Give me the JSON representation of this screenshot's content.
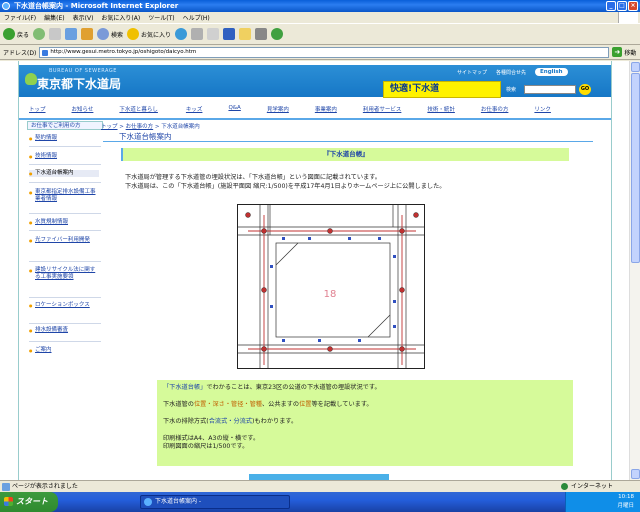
{
  "window": {
    "title": "下水道台帳案内 - Microsoft Internet Explorer"
  },
  "menu": [
    "ファイル(F)",
    "編集(E)",
    "表示(V)",
    "お気に入り(A)",
    "ツール(T)",
    "ヘルプ(H)"
  ],
  "toolbar": {
    "back": "戻る",
    "search": "検索",
    "favorites": "お気に入り"
  },
  "address": {
    "label": "アドレス(D)",
    "url": "http://www.gesui.metro.tokyo.jp/oshigoto/daicyo.htm",
    "go": "移動"
  },
  "header": {
    "sub": "BUREAU OF SEWERAGE",
    "logo": "東京都下水道局",
    "sitemap": "サイトマップ",
    "contact": "各種問合せ先",
    "english": "English",
    "banner": "快適!下水道",
    "search_label": "検索",
    "go": "GO"
  },
  "nav": [
    "トップ",
    "お知らせ",
    "下水道と暮らし",
    "キッズ",
    "Q&A",
    "見学案内",
    "事業案内",
    "利用者サービス",
    "技術・統計",
    "お仕事の方",
    "リンク"
  ],
  "sidebar": {
    "head": "お仕事でご利用の方",
    "items": [
      "契約情報",
      "技術情報",
      "下水道台帳案内",
      "東京都指定排水設備工事業者情報",
      "水質規制情報",
      "光ファイバー利用開発",
      "建設リサイクル法に関する工事実施要領",
      "ロケーションボックス",
      "排水設備審査",
      "ご案内"
    ]
  },
  "crumb": {
    "top": "トップ",
    "sep1": " > ",
    "work": "お仕事の方",
    "sep2": " > ",
    "current": "下水道台帳案内"
  },
  "page_title": "下水道台帳案内",
  "section_head": "『下水道台帳』",
  "intro": [
    "下水道局が管理する下水道管の埋設状況は、「下水道台帳」という図面に記載されています。",
    "下水道局は、この「下水道台帳」(施設平面図 縮尺:1/500)を平成17年4月1日よりホームページ上に公開しました。"
  ],
  "plan": {
    "block_number": "18"
  },
  "info": {
    "l1_a": "「下水道台帳」",
    "l1_b": "でわかることは、東京23区の公道の下水道管の埋設状況です。",
    "l2_a": "下水道管の",
    "l2_b": "位置・深さ・管径・管種",
    "l2_c": "、公共ますの",
    "l2_d": "位置",
    "l2_e": "等を記載しています。",
    "l3_a": "下水の排除方式(",
    "l3_b": "合流式・分流式",
    "l3_c": ")もわかります。",
    "l4": "印刷様式はA4、A3の縦・横です。",
    "l5": "印刷図面の縮尺は1/500です。"
  },
  "status": {
    "text": "ページが表示されました",
    "zone": "インターネット"
  },
  "taskbar": {
    "start": "スタート",
    "task": "下水道台帳案内 -",
    "clock": "10:18",
    "day": "月曜日"
  }
}
